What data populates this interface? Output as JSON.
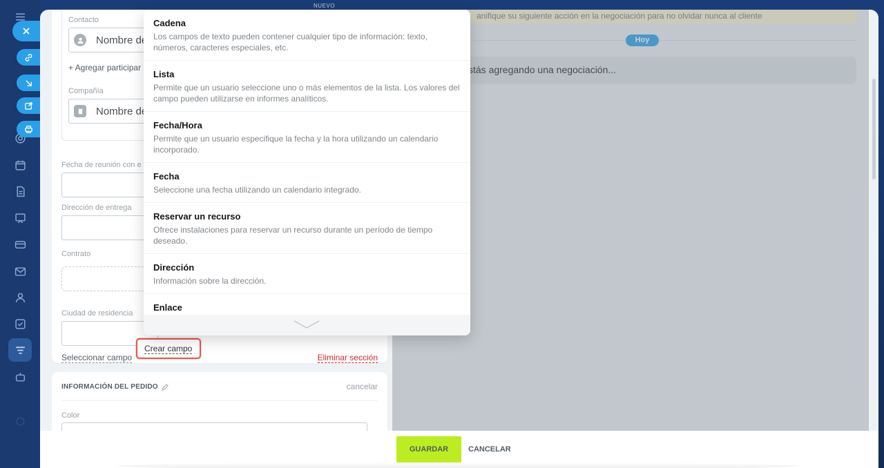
{
  "top_hint": "NUEVO",
  "banner_text": "anifique su siguiente acción en la negociación para no olvidar nunca al cliente",
  "today_badge": "Hoy",
  "deal_message": "stás agregando una negociación...",
  "form": {
    "contact_label": "Contacto",
    "contact_placeholder": "Nombre de",
    "add_participant": "+ Agregar participar",
    "company_label": "Compañía",
    "company_placeholder": "Nombre de",
    "meeting_date_label": "Fecha de reunión con e",
    "delivery_address_label": "Dirección de entrega",
    "contract_label": "Contrato",
    "residence_city_label": "Ciudad de residencia",
    "select_field": "Seleccionar campo",
    "create_field": "Crear campo",
    "delete_section": "Eliminar sección"
  },
  "order_section": {
    "title": "INFORMACIÓN DEL PEDIDO",
    "cancel": "cancelar",
    "color_label": "Color"
  },
  "field_types": [
    {
      "title": "Cadena",
      "description": "Los campos de texto pueden contener cualquier tipo de información: texto, números, caracteres especiales, etc."
    },
    {
      "title": "Lista",
      "description": "Permite que un usuario seleccione uno o más elementos de la lista. Los valores del campo pueden utilizarse en informes analíticos."
    },
    {
      "title": "Fecha/Hora",
      "description": "Permite que un usuario especifique la fecha y la hora utilizando un calendario incorporado."
    },
    {
      "title": "Fecha",
      "description": "Seleccione una fecha utilizando un calendario integrado."
    },
    {
      "title": "Reservar un recurso",
      "description": "Ofrece instalaciones para reservar un recurso durante un período de tiempo deseado."
    },
    {
      "title": "Dirección",
      "description": "Información sobre la dirección."
    },
    {
      "title": "Enlace",
      "description": ""
    }
  ],
  "actions": {
    "save": "GUARDAR",
    "cancel": "CANCELAR"
  },
  "colors": {
    "accent_blue": "#2aa0e8",
    "save_green": "#bbed21",
    "highlight_red": "#e05a4f",
    "delete_red": "#d8262d"
  }
}
